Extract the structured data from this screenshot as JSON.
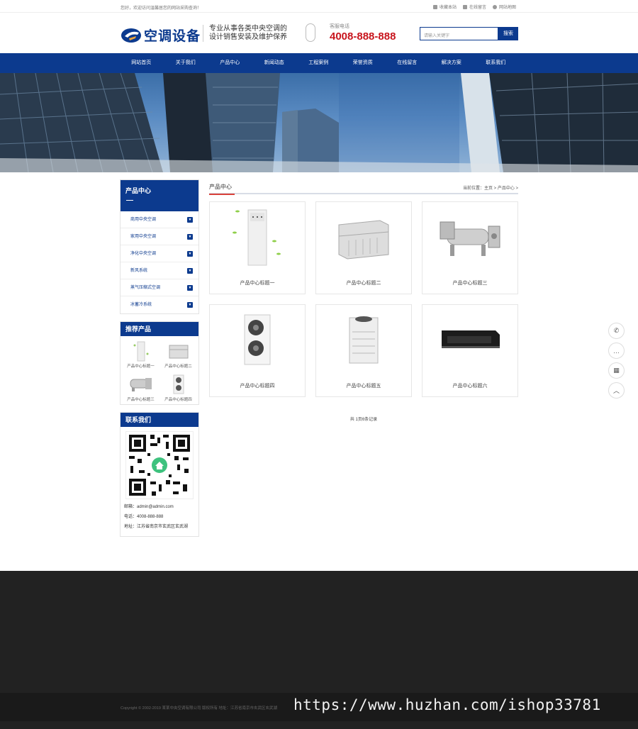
{
  "topbar": {
    "welcome": "您好，欢迎访问温馨居您的网站采购查询！",
    "links": [
      {
        "icon": "star-icon",
        "label": "收藏本站"
      },
      {
        "icon": "message-icon",
        "label": "在线留言"
      },
      {
        "icon": "map-pin-icon",
        "label": "网站地图"
      }
    ]
  },
  "header": {
    "logo_text": "空调设备",
    "slogan_line1": "专业从事各类中央空调的",
    "slogan_line2": "设计销售安装及维护保养",
    "hotline_label": "客服电话",
    "hotline_number": "4008-888-888",
    "search_placeholder": "请输入关键字",
    "search_button": "搜索"
  },
  "nav": [
    "网站首页",
    "关于我们",
    "产品中心",
    "新闻动态",
    "工程案例",
    "荣誉资质",
    "在线留言",
    "解决方案",
    "联系我们"
  ],
  "sidebar": {
    "category_title": "产品中心",
    "categories": [
      "商用中央空调",
      "家用中央空调",
      "净化中央空调",
      "新风系统",
      "蒸气压缩式空调",
      "冰蓄冷系统"
    ],
    "recommend_title": "推荐产品",
    "recommend": [
      "产品中心标题一",
      "产品中心标题二",
      "产品中心标题三",
      "产品中心标题四"
    ],
    "contact_title": "联系我们",
    "email": "邮箱：admin@admin.com",
    "phone": "电话：4008-888-888",
    "address": "地址：江苏省南京市玄武区玄武湖"
  },
  "main": {
    "section_title": "产品中心",
    "breadcrumb": "当前位置：主页 > 产品中心 >",
    "products": [
      "产品中心标题一",
      "产品中心标题二",
      "产品中心标题三",
      "产品中心标题四",
      "产品中心标题五",
      "产品中心标题六"
    ],
    "pager": "共 1页6条记录"
  },
  "float_buttons": [
    "phone-icon",
    "chat-icon",
    "qrcode-icon",
    "back-to-top-icon"
  ],
  "footer": {
    "copyright": "Copyright © 2002-2019 某某中央空调有限公司 版权所有  地址：江苏省南京市玄武区玄武湖",
    "watermark": "https://www.huzhan.com/ishop33781"
  },
  "colors": {
    "brand": "#0c3a8e",
    "accent": "#c8151d",
    "footer": "#222222"
  }
}
